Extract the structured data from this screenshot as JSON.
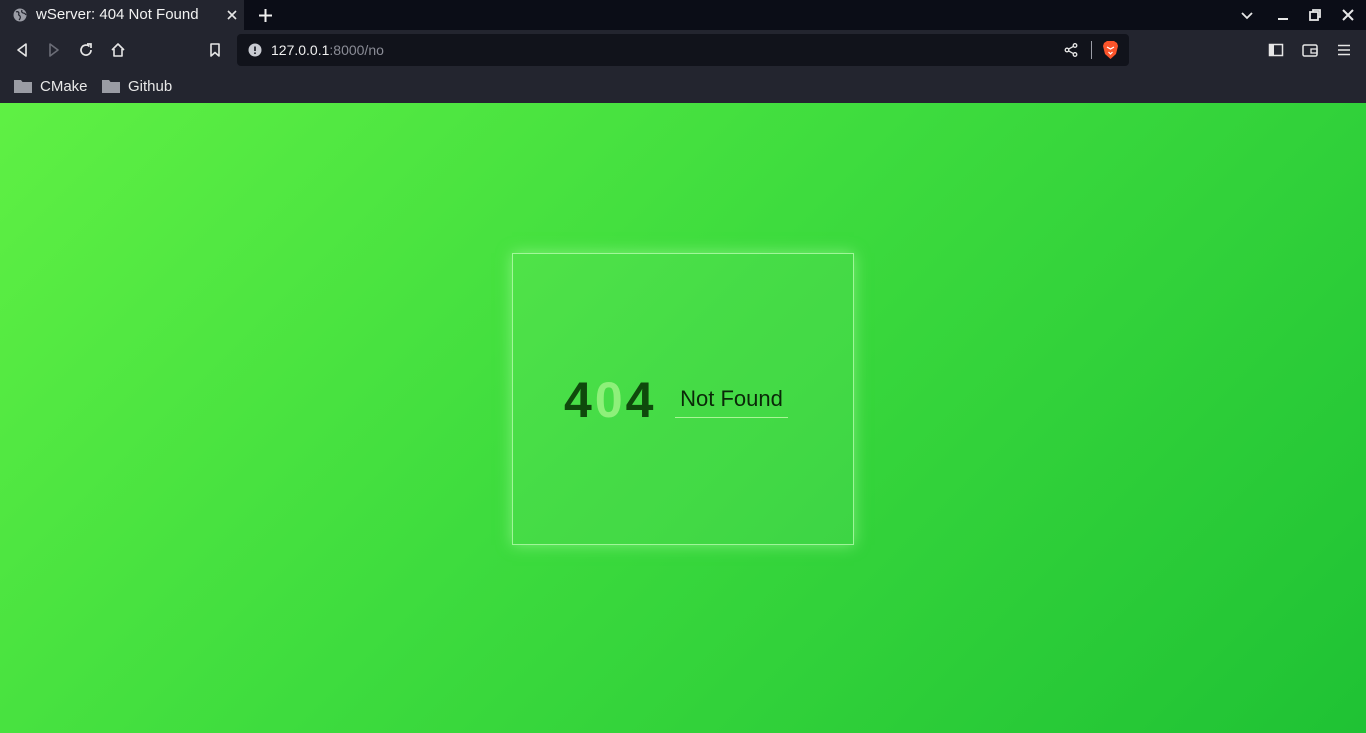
{
  "tab": {
    "title": "wServer: 404 Not Found"
  },
  "toolbar": {
    "url_host": "127.0.0.1",
    "url_rest": ":8000/no"
  },
  "bookmarks": [
    {
      "label": "CMake"
    },
    {
      "label": "Github"
    }
  ],
  "page": {
    "digit_1": "4",
    "digit_2": "0",
    "digit_3": "4",
    "message": "Not Found"
  },
  "colors": {
    "gradient_start": "#5ff044",
    "gradient_end": "#1fc234",
    "digit_dark": "#0f4a0c",
    "digit_light": "#8ef07a"
  },
  "icons": [
    "globe-icon",
    "close-icon",
    "plus-icon",
    "chevron-down-icon",
    "minimize-icon",
    "restore-icon",
    "window-close-icon",
    "back-icon",
    "forward-icon",
    "reload-icon",
    "home-icon",
    "bookmark-icon",
    "info-icon",
    "share-icon",
    "brave-lion-icon",
    "sidebar-icon",
    "wallet-icon",
    "menu-icon",
    "folder-icon"
  ]
}
